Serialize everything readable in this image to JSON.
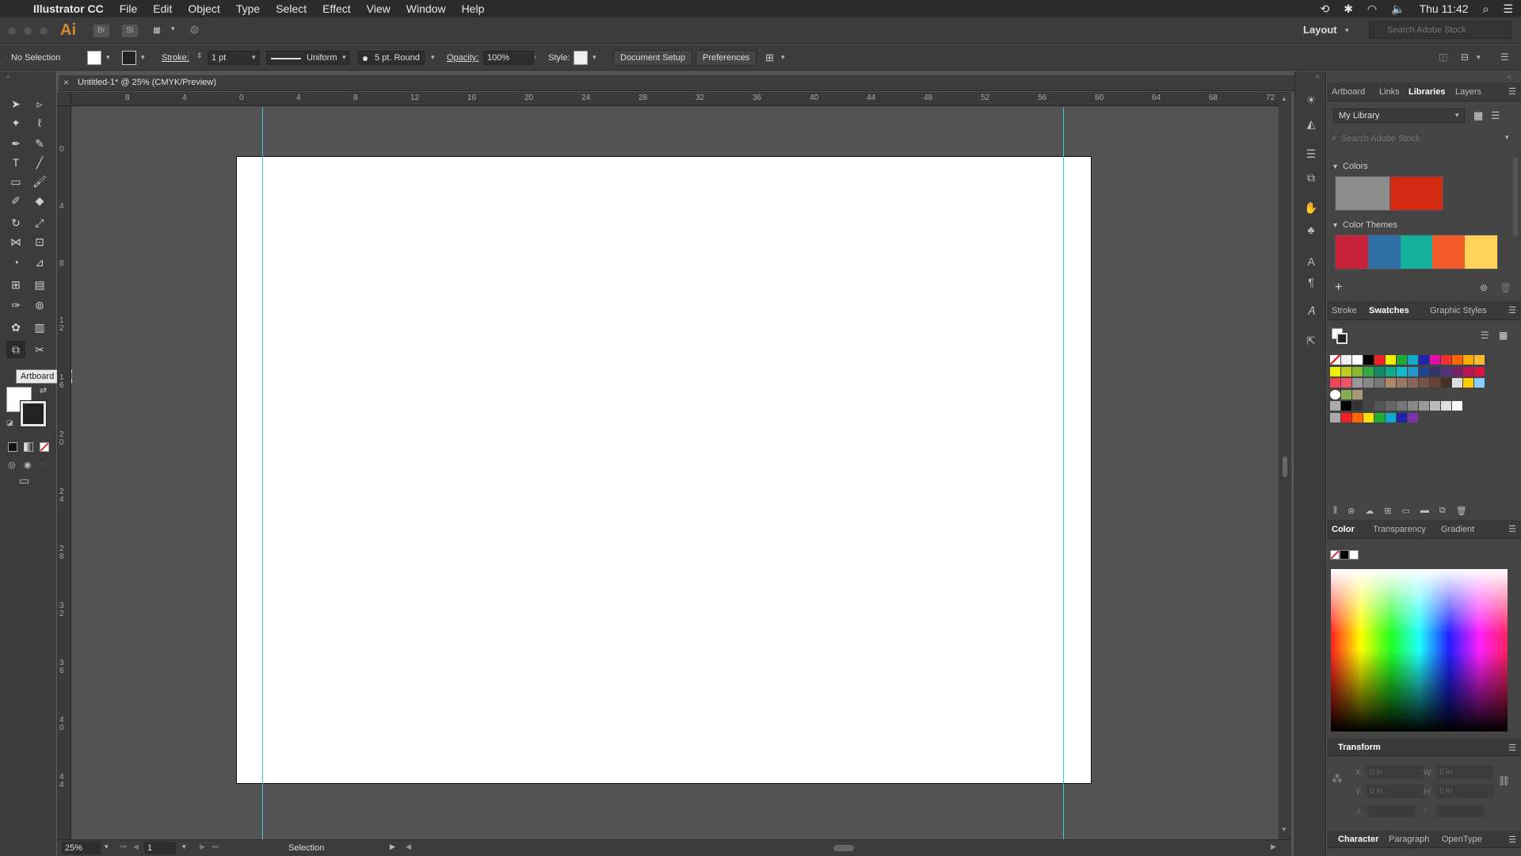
{
  "menubar": {
    "app_name": "Illustrator CC",
    "items": [
      "File",
      "Edit",
      "Object",
      "Type",
      "Select",
      "Effect",
      "View",
      "Window",
      "Help"
    ],
    "clock": "Thu 11:42"
  },
  "appbar": {
    "badge": "Ai",
    "bridge": "Br",
    "stock": "St",
    "workspace": "Layout",
    "stock_search_placeholder": "Search Adobe Stock"
  },
  "control": {
    "selection": "No Selection",
    "stroke_label": "Stroke:",
    "stroke_value": "1 pt",
    "profile": "Uniform",
    "brush": "5 pt. Round",
    "opacity_label": "Opacity:",
    "opacity_value": "100%",
    "style_label": "Style:",
    "doc_setup": "Document Setup",
    "preferences": "Preferences"
  },
  "tooltip": "Artboard Tool (Shift+O)",
  "document": {
    "tab": "Untitled-1* @ 25% (CMYK/Preview)",
    "zoom": "25%",
    "artboard_number": "1",
    "status_text": "Selection"
  },
  "ruler": {
    "h_ticks": [
      "8",
      "4",
      "0",
      "4",
      "8",
      "12",
      "16",
      "20",
      "24",
      "28",
      "32",
      "36",
      "40",
      "44",
      "48",
      "52",
      "56",
      "60",
      "64",
      "68",
      "72"
    ],
    "v_ticks": [
      "0",
      "4",
      "8",
      "1\n2",
      "1\n6",
      "2\n0",
      "2\n4",
      "2\n8",
      "3\n2",
      "3\n6",
      "4\n0",
      "4\n4"
    ]
  },
  "libraries_panel": {
    "tabs": [
      "Artboard",
      "Links",
      "Libraries",
      "Layers"
    ],
    "active": "Libraries",
    "library_name": "My Library",
    "search_placeholder": "Search Adobe Stock",
    "colors_label": "Colors",
    "themes_label": "Color Themes",
    "theme_colors": [
      "#c8223b",
      "#2f6ea7",
      "#14b29c",
      "#f35a2a",
      "#ffd35a"
    ]
  },
  "swatches_panel": {
    "tabs": [
      "Stroke",
      "Swatches",
      "Graphic Styles"
    ],
    "active": "Swatches"
  },
  "color_panel": {
    "tabs": [
      "Color",
      "Transparency",
      "Gradient"
    ],
    "active": "Color"
  },
  "transform_panel": {
    "title": "Transform",
    "x_label": "X:",
    "y_label": "Y:",
    "w_label": "W:",
    "h_label": "H:",
    "x_value": "0 in",
    "y_value": "0 in",
    "w_value": "0 in",
    "h_value": "0 in"
  },
  "character_panel": {
    "tabs": [
      "Character",
      "Paragraph",
      "OpenType"
    ],
    "active": "Character"
  }
}
